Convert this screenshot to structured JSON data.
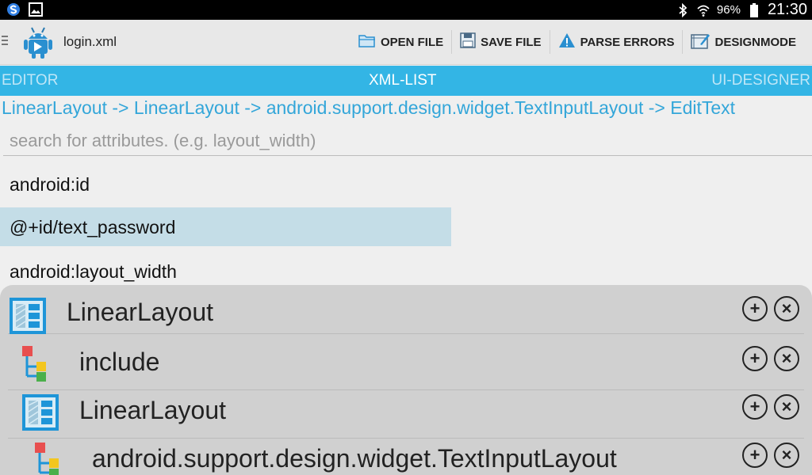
{
  "colors": {
    "accent": "#33b5e5",
    "selected_bg": "#c4dde7",
    "tree_bg": "#d0d0d0"
  },
  "status_bar": {
    "battery": "96%",
    "time": "21:30"
  },
  "action_bar": {
    "title": "login.xml",
    "actions": [
      {
        "label": "OPEN FILE",
        "icon": "folder-icon"
      },
      {
        "label": "SAVE FILE",
        "icon": "floppy-disk-icon"
      },
      {
        "label": "PARSE ERRORS",
        "icon": "warning-icon"
      },
      {
        "label": "DESIGNMODE",
        "icon": "design-mode-icon"
      }
    ]
  },
  "tabs": [
    {
      "label": "EDITOR"
    },
    {
      "label": "XML-LIST"
    },
    {
      "label": "UI-DESIGNER"
    }
  ],
  "breadcrumb": "LinearLayout -> LinearLayout -> android.support.design.widget.TextInputLayout -> EditText",
  "search": {
    "placeholder": "search for attributes. (e.g. layout_width)",
    "value": ""
  },
  "attributes": [
    {
      "name": "android:id",
      "value": "@+id/text_password"
    },
    {
      "name": "android:layout_width"
    }
  ],
  "tree": [
    {
      "label": "LinearLayout",
      "icon": "linear-layout-icon"
    },
    {
      "label": "include",
      "icon": "include-icon"
    },
    {
      "label": "LinearLayout",
      "icon": "linear-layout-icon"
    },
    {
      "label": "android.support.design.widget.TextInputLayout",
      "icon": "include-icon"
    }
  ]
}
